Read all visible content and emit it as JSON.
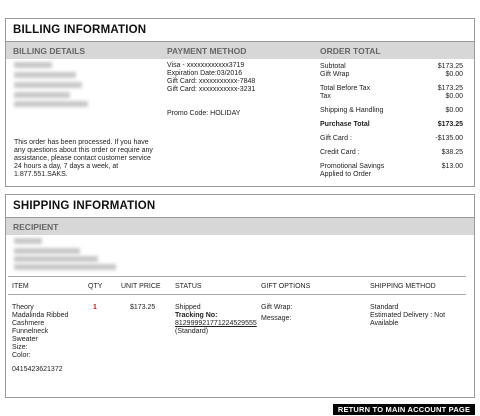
{
  "billing": {
    "title": "BILLING INFORMATION",
    "col_details": "BILLING DETAILS",
    "col_payment": "PAYMENT METHOD",
    "col_total": "ORDER TOTAL",
    "notice": [
      "This order has been processed. If you have",
      "any questions about this order or require any",
      "assistance, please contact customer service",
      "24 hours a day, 7 days a week, at",
      "1.877.551.SAKS."
    ],
    "payment": [
      "Visa - xxxxxxxxxxxx3719",
      "Expiration Date:03/2016",
      "Gift Card: xxxxxxxxxxx-7848",
      "Gift Card: xxxxxxxxxxx-3231"
    ],
    "promo": "Promo Code: HOLIDAY",
    "totals": {
      "subtotal_label": "Subtotal",
      "subtotal": "$173.25",
      "giftwrap_label": "Gift Wrap",
      "giftwrap": "$0.00",
      "before_tax_label": "Total Before Tax",
      "before_tax": "$173.25",
      "tax_label": "Tax",
      "tax": "$0.00",
      "shipping_label": "Shipping & Handling",
      "shipping": "$0.00",
      "purchase_label": "Purchase Total",
      "purchase": "$173.25",
      "giftcard_label": "Gift Card :",
      "giftcard": "-$135.00",
      "credit_label": "Credit Card :",
      "credit": "$38.25",
      "promo_label_1": "Promotional Savings",
      "promo_label_2": "Applied to Order",
      "promo_savings": "$13.00"
    }
  },
  "shipping": {
    "title": "SHIPPING INFORMATION",
    "recipient_label": "RECIPIENT",
    "headers": {
      "item": "ITEM",
      "qty": "QTY",
      "unit_price": "UNIT PRICE",
      "status": "STATUS",
      "gift": "GIFT OPTIONS",
      "method": "SHIPPING METHOD"
    },
    "item_lines": [
      "Theory",
      "Madalinda Ribbed",
      "Cashmere",
      "Funnelneck",
      "Sweater",
      "Size:",
      "Color:"
    ],
    "sku": "0415423621372",
    "qty": "1",
    "unit_price": "$173.25",
    "status": "Shipped",
    "tracking_label": "Tracking No:",
    "tracking_no": "812999921771224529555",
    "tracking_type": "(Standard)",
    "gift_wrap": "Gift Wrap:",
    "gift_message": "Message:",
    "method": "Standard",
    "delivery_1": "Estimated Delivery : Not",
    "delivery_2": "Available"
  },
  "return_button": "RETURN TO MAIN ACCOUNT PAGE"
}
